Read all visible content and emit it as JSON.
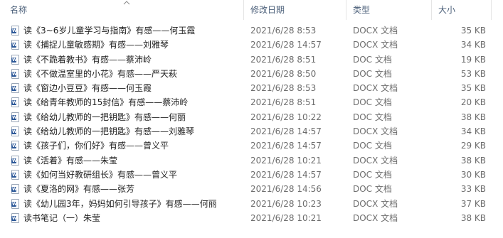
{
  "header": {
    "name": "名称",
    "date": "修改日期",
    "type": "类型",
    "size": "大小"
  },
  "files": [
    {
      "name": "读《3~6岁儿童学习与指南》有感——何玉霞",
      "date": "2021/6/28 8:53",
      "type": "DOCX 文档",
      "size": "35 KB"
    },
    {
      "name": "读《捕捉儿童敏感期》有感——刘雅琴",
      "date": "2021/6/28 14:57",
      "type": "DOCX 文档",
      "size": "34 KB"
    },
    {
      "name": "读《不跪着教书》有感——蔡沛岭",
      "date": "2021/6/28 8:51",
      "type": "DOC 文档",
      "size": "19 KB"
    },
    {
      "name": "读《不做温室里的小花》有感——严天萩",
      "date": "2021/6/28 8:50",
      "type": "DOC 文档",
      "size": "53 KB"
    },
    {
      "name": "读《窗边小豆豆》有感——何玉霞",
      "date": "2021/6/28 8:53",
      "type": "DOCX 文档",
      "size": "35 KB"
    },
    {
      "name": "读《给青年教师的15封信》有感——蔡沛岭",
      "date": "2021/6/28 8:51",
      "type": "DOC 文档",
      "size": "20 KB"
    },
    {
      "name": "读《给幼儿教师的一把钥匙》有感——何丽",
      "date": "2021/6/28 10:22",
      "type": "DOC 文档",
      "size": "38 KB"
    },
    {
      "name": "读《给幼儿教师的一把钥匙》有感——刘雅琴",
      "date": "2021/6/28 14:57",
      "type": "DOCX 文档",
      "size": "34 KB"
    },
    {
      "name": "读《孩子们，你们好》有感——曾义平",
      "date": "2021/6/28 14:57",
      "type": "DOC 文档",
      "size": "29 KB"
    },
    {
      "name": "读《活着》有感——朱莹",
      "date": "2021/6/28 10:21",
      "type": "DOCX 文档",
      "size": "38 KB"
    },
    {
      "name": "读《如何当好教研组长》有感——曾义平",
      "date": "2021/6/28 14:57",
      "type": "DOC 文档",
      "size": "30 KB"
    },
    {
      "name": "读《夏洛的网》有感——张芳",
      "date": "2021/6/28 14:56",
      "type": "DOC 文档",
      "size": "33 KB"
    },
    {
      "name": "读《幼儿园3年，妈妈如何引导孩子》有感——何丽",
      "date": "2021/6/28 10:23",
      "type": "DOCX 文档",
      "size": "37 KB"
    },
    {
      "name": "读书笔记（一）朱莹",
      "date": "2021/6/28 10:21",
      "type": "DOCX 文档",
      "size": "38 KB"
    }
  ]
}
